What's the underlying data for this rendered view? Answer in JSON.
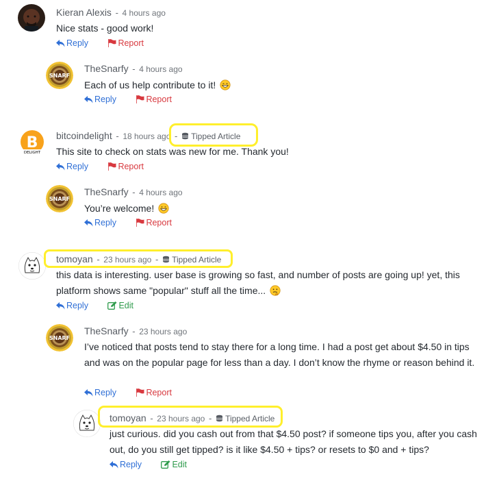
{
  "actions": {
    "reply": "Reply",
    "report": "Report",
    "edit": "Edit"
  },
  "sep": "-",
  "comments": [
    {
      "author": "Kieran Alexis",
      "time": "4 hours ago",
      "text": "Nice stats - good work!",
      "secondary_action": "Report"
    },
    {
      "author": "TheSnarfy",
      "time": "4 hours ago",
      "text": "Each of us help contribute to it!",
      "secondary_action": "Report"
    },
    {
      "author": "bitcoindelight",
      "time": "18 hours ago",
      "badge": "Tipped Article",
      "text": "This site to check on stats was new for me. Thank you!",
      "secondary_action": "Report"
    },
    {
      "author": "TheSnarfy",
      "time": "4 hours ago",
      "text": "You’re welcome!",
      "secondary_action": "Report"
    },
    {
      "author": "tomoyan",
      "time": "23 hours ago",
      "badge": "Tipped Article",
      "text": "this data is interesting. user base is growing so fast, and number of posts are going up! yet, this platform shows same \"popular\" stuff all the time...",
      "secondary_action": "Edit"
    },
    {
      "author": "TheSnarfy",
      "time": "23 hours ago",
      "text": "I’ve noticed that posts tend to stay there for a long time. I had a post get about $4.50 in tips and was on the popular page for less than a day. I don’t know the rhyme or reason behind it.",
      "secondary_action": "Report"
    },
    {
      "author": "tomoyan",
      "time": "23 hours ago",
      "badge": "Tipped Article",
      "text": "just curious. did you cash out from that $4.50 post? if someone tips you, after you cash out, do you still get tipped? is it like $4.50 + tips? or resets to $0 and + tips?",
      "secondary_action": "Edit"
    }
  ],
  "colors": {
    "reply": "#2f6fd6",
    "report": "#d8393f",
    "edit": "#2f9b4c",
    "highlight": "#ffef2c",
    "author": "#565b62",
    "text": "#24292f"
  },
  "icons": {
    "reply": "reply-arrow-icon",
    "report": "flag-icon",
    "edit": "edit-icon",
    "tipped": "coins-icon",
    "emoji_grin": "grinning-emoji-icon",
    "emoji_thinking": "thinking-emoji-icon"
  }
}
